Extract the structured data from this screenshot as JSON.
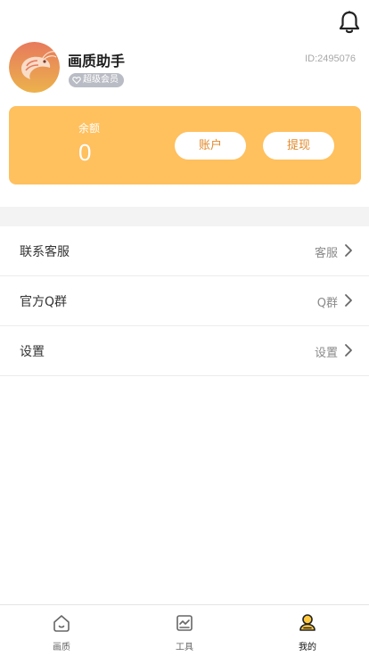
{
  "header": {
    "notification_icon": "bell-icon"
  },
  "profile": {
    "name": "画质助手",
    "vip_label": "超级会员",
    "vip_icon": "heart-icon",
    "id_text": "ID:2495076",
    "avatar_icon": "shrimp-avatar"
  },
  "balance": {
    "label": "余额",
    "value": "0",
    "account_button": "账户",
    "withdraw_button": "提现",
    "card_color": "#ffc05e"
  },
  "menu": {
    "items": [
      {
        "label": "联系客服",
        "value": "客服"
      },
      {
        "label": "官方Q群",
        "value": "Q群"
      },
      {
        "label": "设置",
        "value": "设置"
      }
    ]
  },
  "tabbar": {
    "tabs": [
      {
        "label": "画质",
        "icon": "home-icon"
      },
      {
        "label": "工具",
        "icon": "tools-icon"
      },
      {
        "label": "我的",
        "icon": "profile-icon",
        "active": true
      }
    ]
  }
}
